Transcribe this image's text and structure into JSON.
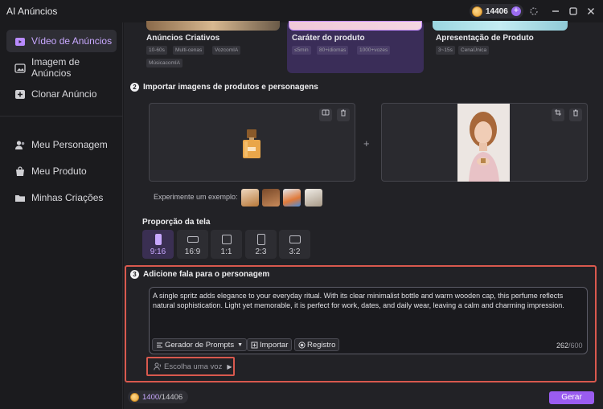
{
  "app": {
    "title": "AI Anúncios"
  },
  "header": {
    "credits": "14406"
  },
  "sidebar": {
    "items": [
      {
        "label": "Vídeo de Anúncios"
      },
      {
        "label": "Imagem de Anúncios"
      },
      {
        "label": "Clonar Anúncio"
      },
      {
        "label": "Meu Personagem"
      },
      {
        "label": "Meu Produto"
      },
      {
        "label": "Minhas Criações"
      }
    ]
  },
  "templates": [
    {
      "title": "Anúncios Criativos",
      "tags": [
        "10-60s",
        "Multi-cenas",
        "VozcomIA",
        "MúsicacomIA"
      ]
    },
    {
      "title": "Caráter do produto",
      "tags": [
        "≤5min",
        "80+idiomas",
        "1000+vozes"
      ]
    },
    {
      "title": "Apresentação de Produto",
      "tags": [
        "3~15s",
        "CenaÚnica"
      ]
    }
  ],
  "import_section": {
    "step": "2",
    "title": "Importar imagens de produtos e personagens",
    "try_example": "Experimente um exemplo:"
  },
  "ratio": {
    "title": "Proporção da tela",
    "options": [
      "9:16",
      "16:9",
      "1:1",
      "2:3",
      "3:2"
    ],
    "selected": "9:16"
  },
  "speech": {
    "step": "3",
    "title": "Adicione fala para o personagem",
    "text": "A single spritz adds elegance to your everyday ritual. With its clear minimalist bottle and warm wooden cap, this perfume reflects natural sophistication. Light yet memorable, it is perfect for work, dates, and daily wear, leaving a calm and charming impression.",
    "prompt_generator": "Gerador de Prompts",
    "import": "Importar",
    "record": "Registro",
    "count": "262",
    "max": "/600",
    "voice_placeholder": "Escolha uma voz"
  },
  "footer": {
    "used": "1400",
    "total": "/14406",
    "generate": "Gerar"
  },
  "colors": {
    "accent": "#9a5cf0",
    "highlight_border": "#d9594e"
  }
}
